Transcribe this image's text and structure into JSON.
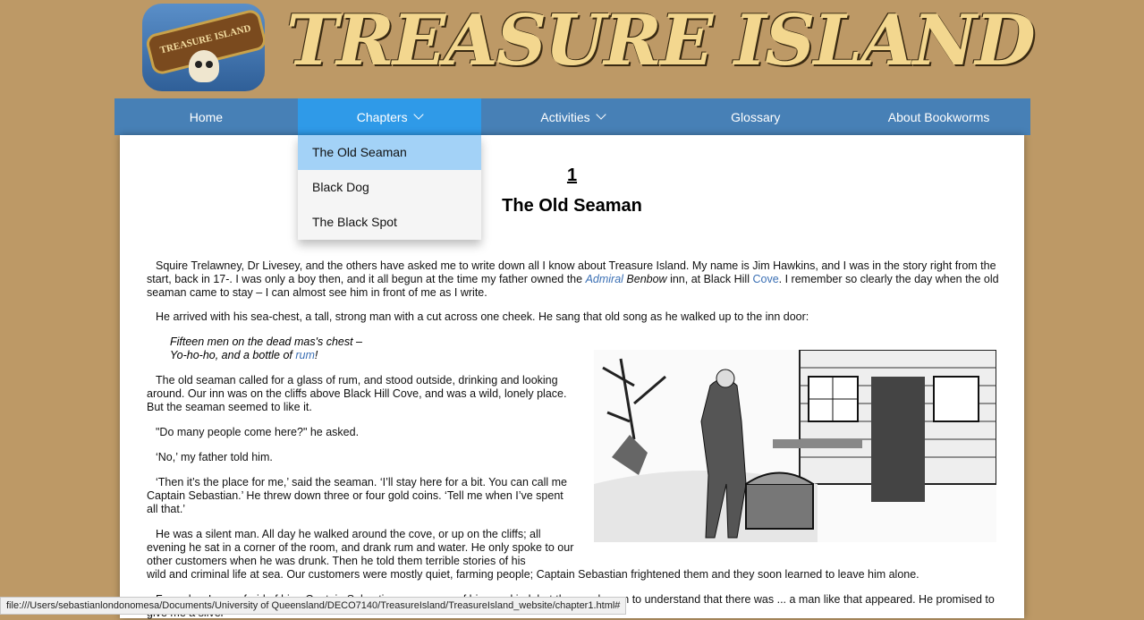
{
  "header": {
    "logo_text": "TREASURE ISLAND",
    "site_title": "TREASURE ISLAND"
  },
  "nav": {
    "items": [
      {
        "label": "Home"
      },
      {
        "label": "Chapters"
      },
      {
        "label": "Activities"
      },
      {
        "label": "Glossary"
      },
      {
        "label": "About Bookworms"
      }
    ],
    "chapters_menu": [
      "The Old Seaman",
      "Black Dog",
      "The Black Spot"
    ]
  },
  "chapter": {
    "number": "1",
    "title": "The Old Seaman",
    "p1_a": "Squire Trelawney, Dr Livesey, and the others have asked me to write down all I know about Treasure Island. My name is Jim Hawkins, and I was in the story right from the start, back in 17-. I was only a boy then, and it all begun at the time my father owned the ",
    "p1_admiral": "Admiral",
    "p1_benbow": " Benbow",
    "p1_b": " inn, at Black Hill ",
    "p1_cove": "Cove",
    "p1_c": ". I remember so clearly the day when the old seaman came to stay – I can almost see him in front of me as I write.",
    "p2": "He arrived with his sea-chest, a tall, strong man with a cut across one cheek. He sang that old song as he walked up to the inn door:",
    "poem_line1": "Fifteen men on the dead mas's chest –",
    "poem_line2a": "Yo-ho-ho, and a bottle of ",
    "poem_rum": "rum",
    "poem_line2b": "!",
    "p3": "The old seaman called for a glass of rum, and stood outside, drinking and looking around. Our inn was on the cliffs above Black Hill Cove, and was a wild, lonely place. But the seaman seemed to like it.",
    "p4": "\"Do many people come here?\" he asked.",
    "p5": "‘No,’ my father told him.",
    "p6": "‘Then it’s the place for me,’ said the seaman. ‘I’ll stay here for a bit. You can call me Captain Sebastian.’ He threw down three or four gold coins. ‘Tell me when I’ve spent all that.’",
    "p7_a": "He was a silent man. All day he walked around the cove, or up on the cliffs; all evening he sat in a corner of the room, and drank rum and water. He only spoke to our other customers when he was drunk. Then he told them terrible stories of his",
    "p7_b": "wild and criminal life at sea. Our customers were mostly quiet, farming people; Captain Sebastian frightened them and they soon learned to leave him alone.",
    "p8": "For a day. I was afraid of him. Captain Sebastian was a man of his own kind, but then we began to understand that there was ... a man like that appeared. He promised to give me a silver"
  },
  "status_url": "file:///Users/sebastianlondonomesa/Documents/University of Queensland/DECO7140/TreasureIsland/TreasureIsland_website/chapter1.html#"
}
